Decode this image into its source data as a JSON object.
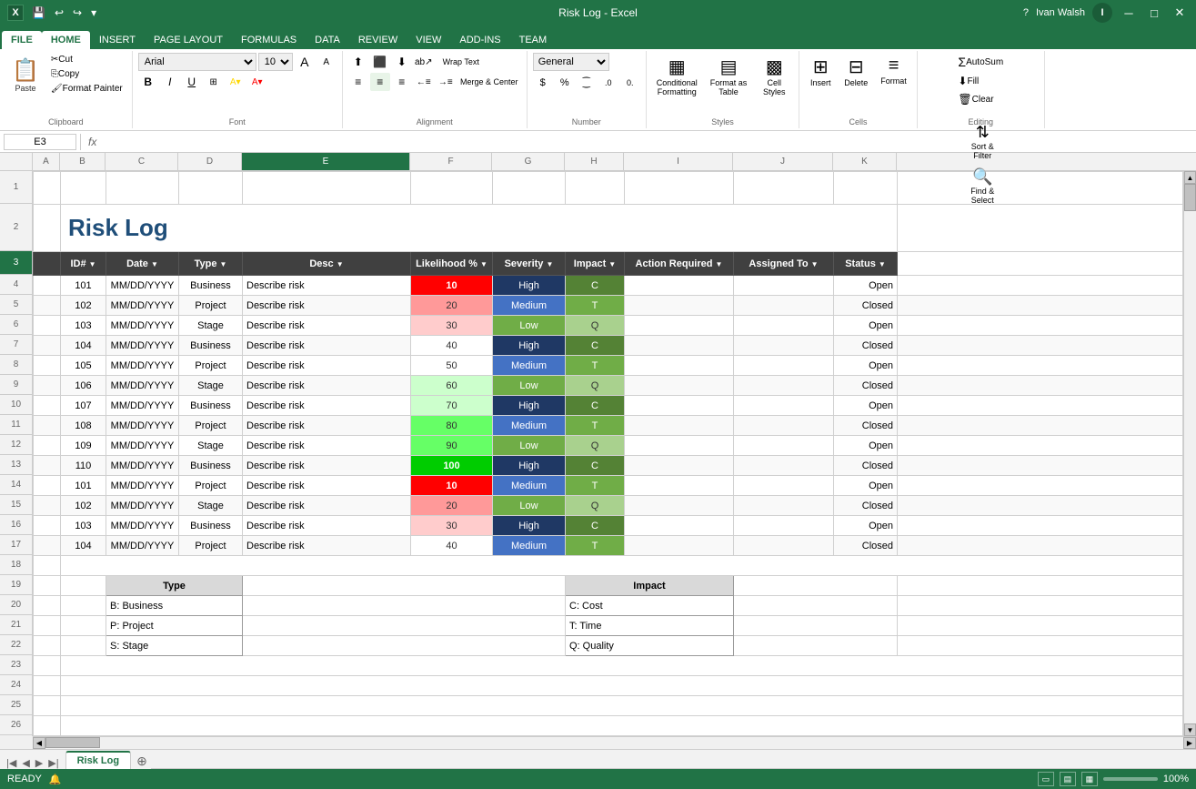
{
  "titleBar": {
    "appTitle": "Risk Log - Excel",
    "userName": "Ivan Walsh",
    "userInitial": "I"
  },
  "ribbonTabs": [
    "FILE",
    "HOME",
    "INSERT",
    "PAGE LAYOUT",
    "FORMULAS",
    "DATA",
    "REVIEW",
    "VIEW",
    "ADD-INS",
    "TEAM"
  ],
  "activeTab": "HOME",
  "ribbon": {
    "clipboard": {
      "label": "Clipboard",
      "paste": "Paste",
      "cut": "Cut",
      "copy": "Copy",
      "formatPainter": "Format Painter"
    },
    "font": {
      "label": "Font",
      "fontName": "Arial",
      "fontSize": "10"
    },
    "alignment": {
      "label": "Alignment",
      "wrapText": "Wrap Text",
      "mergCenter": "Merge & Center"
    },
    "number": {
      "label": "Number",
      "format": "General"
    },
    "styles": {
      "label": "Styles",
      "conditional": "Conditional Formatting",
      "formatTable": "Format as Table",
      "cellStyles": "Cell Styles"
    },
    "cells": {
      "label": "Cells",
      "insert": "Insert",
      "delete": "Delete",
      "format": "Format"
    },
    "editing": {
      "label": "Editing",
      "autoSum": "AutoSum",
      "fill": "Fill",
      "clear": "Clear",
      "sortFilter": "Sort & Filter",
      "findSelect": "Find & Select"
    }
  },
  "nameBox": "E3",
  "formulaBar": "",
  "sheetTitle": "Risk Log",
  "headers": [
    "ID#",
    "Date",
    "Type",
    "Desc",
    "Likelihood %",
    "Severity",
    "Impact",
    "Action Required",
    "Assigned To",
    "Status"
  ],
  "rows": [
    {
      "id": "101",
      "date": "MM/DD/YYYY",
      "type": "Business",
      "desc": "Describe risk",
      "likelihood": "10",
      "likClass": "like-red",
      "severity": "High",
      "sevClass": "sev-high",
      "impact": "C",
      "impClass": "imp-c",
      "actionRequired": "",
      "assignedTo": "",
      "status": "Open"
    },
    {
      "id": "102",
      "date": "MM/DD/YYYY",
      "type": "Project",
      "desc": "Describe risk",
      "likelihood": "20",
      "likClass": "like-salmon",
      "severity": "Medium",
      "sevClass": "sev-med",
      "impact": "T",
      "impClass": "imp-t",
      "actionRequired": "",
      "assignedTo": "",
      "status": "Closed"
    },
    {
      "id": "103",
      "date": "MM/DD/YYYY",
      "type": "Stage",
      "desc": "Describe risk",
      "likelihood": "30",
      "likClass": "like-peach",
      "severity": "Low",
      "sevClass": "sev-low",
      "impact": "Q",
      "impClass": "imp-q",
      "actionRequired": "",
      "assignedTo": "",
      "status": "Open"
    },
    {
      "id": "104",
      "date": "MM/DD/YYYY",
      "type": "Business",
      "desc": "Describe risk",
      "likelihood": "40",
      "likClass": "",
      "severity": "High",
      "sevClass": "sev-high",
      "impact": "C",
      "impClass": "imp-c",
      "actionRequired": "",
      "assignedTo": "",
      "status": "Closed"
    },
    {
      "id": "105",
      "date": "MM/DD/YYYY",
      "type": "Project",
      "desc": "Describe risk",
      "likelihood": "50",
      "likClass": "",
      "severity": "Medium",
      "sevClass": "sev-med",
      "impact": "T",
      "impClass": "imp-t",
      "actionRequired": "",
      "assignedTo": "",
      "status": "Open"
    },
    {
      "id": "106",
      "date": "MM/DD/YYYY",
      "type": "Stage",
      "desc": "Describe risk",
      "likelihood": "60",
      "likClass": "like-green-light",
      "severity": "Low",
      "sevClass": "sev-low",
      "impact": "Q",
      "impClass": "imp-q",
      "actionRequired": "",
      "assignedTo": "",
      "status": "Closed"
    },
    {
      "id": "107",
      "date": "MM/DD/YYYY",
      "type": "Business",
      "desc": "Describe risk",
      "likelihood": "70",
      "likClass": "like-green-light",
      "severity": "High",
      "sevClass": "sev-high",
      "impact": "C",
      "impClass": "imp-c",
      "actionRequired": "",
      "assignedTo": "",
      "status": "Open"
    },
    {
      "id": "108",
      "date": "MM/DD/YYYY",
      "type": "Project",
      "desc": "Describe risk",
      "likelihood": "80",
      "likClass": "like-green",
      "severity": "Medium",
      "sevClass": "sev-med",
      "impact": "T",
      "impClass": "imp-t",
      "actionRequired": "",
      "assignedTo": "",
      "status": "Closed"
    },
    {
      "id": "109",
      "date": "MM/DD/YYYY",
      "type": "Stage",
      "desc": "Describe risk",
      "likelihood": "90",
      "likClass": "like-green",
      "severity": "Low",
      "sevClass": "sev-low",
      "impact": "Q",
      "impClass": "imp-q",
      "actionRequired": "",
      "assignedTo": "",
      "status": "Open"
    },
    {
      "id": "110",
      "date": "MM/DD/YYYY",
      "type": "Business",
      "desc": "Describe risk",
      "likelihood": "100",
      "likClass": "like-green-med",
      "severity": "High",
      "sevClass": "sev-high",
      "impact": "C",
      "impClass": "imp-c",
      "actionRequired": "",
      "assignedTo": "",
      "status": "Closed"
    },
    {
      "id": "101",
      "date": "MM/DD/YYYY",
      "type": "Project",
      "desc": "Describe risk",
      "likelihood": "10",
      "likClass": "like-red",
      "severity": "Medium",
      "sevClass": "sev-med",
      "impact": "T",
      "impClass": "imp-t",
      "actionRequired": "",
      "assignedTo": "",
      "status": "Open"
    },
    {
      "id": "102",
      "date": "MM/DD/YYYY",
      "type": "Stage",
      "desc": "Describe risk",
      "likelihood": "20",
      "likClass": "like-salmon",
      "severity": "Low",
      "sevClass": "sev-low",
      "impact": "Q",
      "impClass": "imp-q",
      "actionRequired": "",
      "assignedTo": "",
      "status": "Closed"
    },
    {
      "id": "103",
      "date": "MM/DD/YYYY",
      "type": "Business",
      "desc": "Describe risk",
      "likelihood": "30",
      "likClass": "like-peach",
      "severity": "High",
      "sevClass": "sev-high",
      "impact": "C",
      "impClass": "imp-c",
      "actionRequired": "",
      "assignedTo": "",
      "status": "Open"
    },
    {
      "id": "104",
      "date": "MM/DD/YYYY",
      "type": "Project",
      "desc": "Describe risk",
      "likelihood": "40",
      "likClass": "",
      "severity": "Medium",
      "sevClass": "sev-med",
      "impact": "T",
      "impClass": "imp-t",
      "actionRequired": "",
      "assignedTo": "",
      "status": "Closed"
    }
  ],
  "legend": {
    "type": {
      "title": "Type",
      "items": [
        "B:  Business",
        "P:  Project",
        "S:  Stage"
      ]
    },
    "impact": {
      "title": "Impact",
      "items": [
        "C:  Cost",
        "T:  Time",
        "Q:  Quality"
      ]
    }
  },
  "sheetTabs": [
    "Risk Log"
  ],
  "status": {
    "ready": "READY",
    "zoom": "100%"
  },
  "colWidths": [
    "50",
    "80",
    "70",
    "185",
    "90",
    "80",
    "65",
    "120",
    "110",
    "70"
  ]
}
